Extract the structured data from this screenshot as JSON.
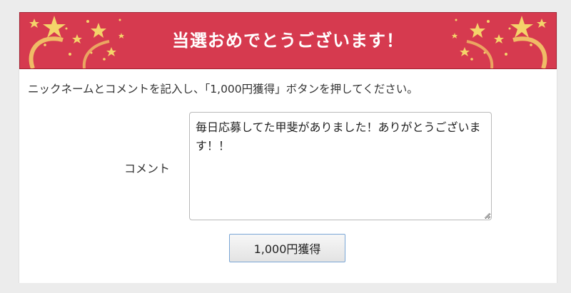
{
  "banner": {
    "title": "当選おめでとうございます！"
  },
  "instruction": "ニックネームとコメントを記入し、「1,000円獲得」ボタンを押してください。",
  "comment": {
    "label": "コメント",
    "value": "毎日応募してた甲斐がありました！ありがとうございます！！"
  },
  "submit_button": {
    "label": "1,000円獲得"
  },
  "colors": {
    "banner_red": "#d63a4f",
    "star_gold": "#f4d36a",
    "page_bg": "#ececec",
    "button_border": "#7aa6d6"
  }
}
